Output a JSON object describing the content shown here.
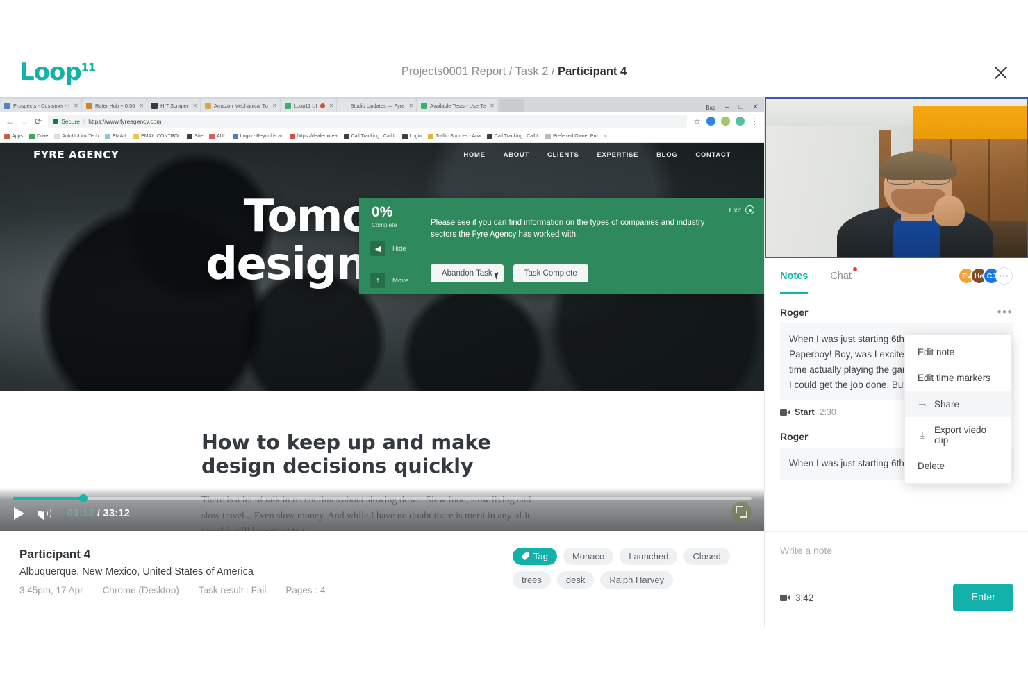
{
  "header": {
    "logo": "Loop",
    "logo_sup": "11",
    "breadcrumb_prefix": "Projects0001 Report / Task 2 / ",
    "breadcrumb_current": "Participant 4",
    "close_icon": "close-icon"
  },
  "browser": {
    "tabs": [
      {
        "title": "Prospects - Customer - I",
        "favicon": "#4a7fc1",
        "recording": false
      },
      {
        "title": "Rater Hub + 0:56",
        "favicon": "#c8821c",
        "recording": false
      },
      {
        "title": "HIT Scraper",
        "favicon": "#2d2d2d",
        "recording": false
      },
      {
        "title": "Amazon Mechanical Tu",
        "favicon": "#d8a33b",
        "recording": false
      },
      {
        "title": "Loop11 UI",
        "favicon": "#2eae63",
        "recording": true
      },
      {
        "title": "Studio Updates — Fyre",
        "favicon": "#e4e6e8",
        "recording": false
      },
      {
        "title": "Available Tests - UserTe",
        "favicon": "#2eae63",
        "recording": false
      }
    ],
    "window_label": "Bas",
    "window_minimize": "–",
    "window_maximize": "□",
    "window_close": "✕",
    "url": {
      "back_icon": "back-arrow-icon",
      "forward_icon": "forward-arrow-icon",
      "reload_icon": "reload-icon",
      "secure_label": "Secure",
      "separator": "|",
      "value": "https://www.fyreagency.com",
      "star_icon": "bookmark-star-icon",
      "menu_icon": "chrome-menu-icon"
    },
    "bookmarks": [
      {
        "label": "Apps",
        "color": "#cf5b44"
      },
      {
        "label": "Drive",
        "color": "#3aa757"
      },
      {
        "label": "AutoUpLink Tech",
        "color": "#dcdfe2"
      },
      {
        "label": "EMAIL",
        "color": "#8fc6d6"
      },
      {
        "label": "EMAIL CONTROL",
        "color": "#e8c84a"
      },
      {
        "label": "Site",
        "color": "#3c3f42"
      },
      {
        "label": "AUL",
        "color": "#e05c5c"
      },
      {
        "label": "Login - Reynolds an",
        "color": "#4a7fc1"
      },
      {
        "label": "https://dealer.xtrea",
        "color": "#d84b4b"
      },
      {
        "label": "Call Tracking : Call L",
        "color": "#3c3f42"
      },
      {
        "label": "Login",
        "color": "#3c3f42"
      },
      {
        "label": "Traffic Sources - Ana",
        "color": "#e8b23a"
      },
      {
        "label": "Call Tracking : Call L",
        "color": "#3c3f42"
      },
      {
        "label": "Preferred Owner Pro",
        "color": "#b9bcbf"
      }
    ]
  },
  "site": {
    "brand": "FYRE AGENCY",
    "nav": [
      "HOME",
      "ABOUT",
      "CLIENTS",
      "EXPERTISE",
      "BLOG",
      "CONTACT"
    ],
    "hero_line1": "Tomorrow's",
    "hero_line2": "designs, today",
    "article_heading": "How to keep up and make design decisions quickly",
    "article_body": "There is a lot of talk in recent times about slowing down. Slow food, slow living and slow travel... Even slow money. And while I have no doubt there is merit in any of it, speed is still important to us."
  },
  "task_overlay": {
    "percent": "0%",
    "percent_label": "Complete",
    "instruction": "Please see if you can find information on the types of companies and industry sectors the Fyre Agency has worked with.",
    "hide_label": "Hide",
    "hide_icon": "hide-arrow-icon",
    "move_label": "Move",
    "move_icon": "move-updown-icon",
    "exit_label": "Exit",
    "exit_icon": "exit-circle-icon",
    "abandon_button": "Abandon Task",
    "complete_button": "Task Complete",
    "bg_color": "#2e8a5c"
  },
  "video": {
    "play_icon": "play-icon",
    "volume_icon": "volume-icon",
    "current_time": "03:12",
    "separator": "/",
    "duration": "33:12",
    "progress_percent": 9.6,
    "fullscreen_icon": "fullscreen-icon",
    "accent_color": "#14b6ad"
  },
  "participant": {
    "name": "Participant 4",
    "location": "Albuquerque, New Mexico, United States of America",
    "meta": [
      "3:45pm, 17 Apr",
      "Chrome (Desktop)",
      "Task result : Fail",
      "Pages : 4"
    ],
    "tag_button": "Tag",
    "tag_icon": "tag-icon",
    "tags": [
      "Monaco",
      "Launched",
      "Closed",
      "trees",
      "desk",
      "Ralph Harvey"
    ]
  },
  "right_panel": {
    "tabs": [
      {
        "label": "Notes",
        "active": true,
        "badge": false
      },
      {
        "label": "Chat",
        "active": false,
        "badge": true
      }
    ],
    "avatars": [
      {
        "initials": "Ev",
        "color": "#f0a33a"
      },
      {
        "initials": "He",
        "color": "#7d4d2c"
      },
      {
        "initials": "CJ",
        "color": "#1577e8"
      },
      {
        "initials": "···",
        "color": "#ffffff"
      }
    ],
    "notes": [
      {
        "author": "Roger",
        "text": "When I was just starting 6th grade I got my first job. Paperboy! Boy, was I excited. I had spent a lot of time actually playing the game Paperboy, so I knew I could get the job done. But, its just not...",
        "time_label": "Start",
        "time_value": "2:30",
        "camera_icon": "camera-icon",
        "menu_icon": "more-dots-icon"
      },
      {
        "author": "Roger",
        "text": "When I was just starting 6th grade I got my first",
        "time_label": "",
        "time_value": "",
        "camera_icon": "camera-icon",
        "menu_icon": "more-dots-icon"
      }
    ],
    "context_menu": [
      {
        "label": "Edit note",
        "icon": "",
        "hover": false
      },
      {
        "label": "Edit time markers",
        "icon": "",
        "hover": false
      },
      {
        "label": "Share",
        "icon": "share-icon",
        "hover": true
      },
      {
        "label": "Export viedo clip",
        "icon": "download-icon",
        "hover": false
      },
      {
        "label": "Delete",
        "icon": "",
        "hover": false
      }
    ],
    "note_placeholder": "Write a note",
    "input_time": "3:42",
    "input_camera_icon": "camera-icon",
    "enter_button": "Enter",
    "accent_color": "#12b2ab"
  }
}
